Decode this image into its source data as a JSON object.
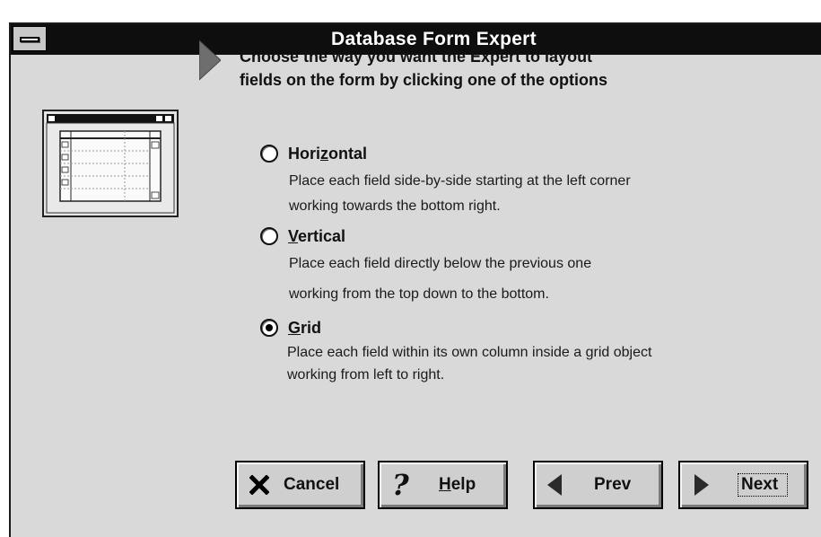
{
  "window": {
    "title": "Database Form Expert"
  },
  "instruction": {
    "line1": "Choose the way you want the Expert to layout",
    "line2": "fields on the form by clicking one of the options"
  },
  "options": [
    {
      "label": "Horizontal",
      "mnemonic_index": 4,
      "selected": false,
      "desc1": "Place each field side-by-side starting at the left corner",
      "desc2": "working towards the bottom right."
    },
    {
      "label": "Vertical",
      "mnemonic_index": 0,
      "selected": false,
      "desc1": "Place each field directly below the previous one",
      "desc2": "working from the top down to the bottom."
    },
    {
      "label": "Grid",
      "mnemonic_index": 0,
      "selected": true,
      "desc1": "Place each field within its own column inside a grid object",
      "desc2": "working from left to right."
    }
  ],
  "buttons": {
    "cancel": "Cancel",
    "help": "Help",
    "prev": "Prev",
    "next": "Next"
  },
  "icons": {
    "sysmenu": "system-menu-icon",
    "arrow": "triangle-pointer-icon",
    "cancel": "x-icon",
    "help": "question-mark-icon",
    "prev": "left-triangle-icon",
    "next": "right-triangle-icon"
  }
}
